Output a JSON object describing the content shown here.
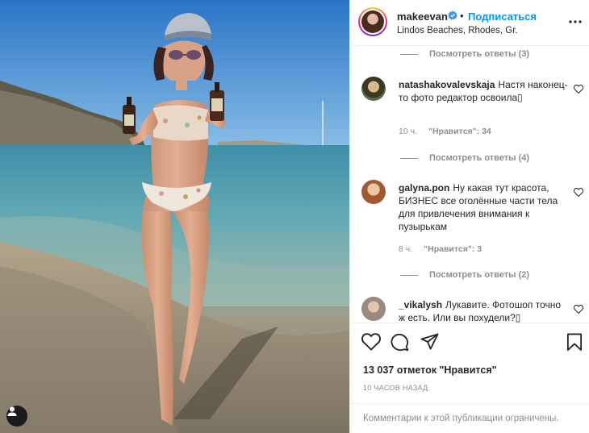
{
  "post": {
    "username": "makeevan",
    "follow_label": "Подписаться",
    "separator": "•",
    "location": "Lindos Beaches, Rhodes, Gr.",
    "likes_text": "13 037 отметок \"Нравится\"",
    "time_ago": "10 ЧАСОВ НАЗАД",
    "comments_restricted": "Комментарии к этой публикации ограничены."
  },
  "comments": {
    "replies": [
      {
        "label": "Посмотреть ответы (3)"
      },
      {
        "label": "Посмотреть ответы (4)"
      },
      {
        "label": "Посмотреть ответы (2)"
      }
    ],
    "items": [
      {
        "user": "natashakovalevskaja",
        "text": "Настя наконец-то фото редактор освоила▯",
        "time": "10 ч.",
        "likes": "\"Нравится\": 34"
      },
      {
        "user": "galyna.pon",
        "text": "Ну какая тут красота, БИЗНЕС все оголённые части тела для привлечения внимания к пузырькам",
        "time": "8 ч.",
        "likes": "\"Нравится\": 3"
      },
      {
        "user": "_vikalysh",
        "text": "Лукавите. Фотошоп точно ж есть. Или вы похудели?▯",
        "time": "",
        "likes": ""
      }
    ]
  },
  "icons": {
    "verified": "verified-badge-icon",
    "more": "more-options-icon",
    "like": "heart-icon",
    "comment": "comment-icon",
    "share": "paper-plane-icon",
    "save": "bookmark-icon",
    "user_tag": "user-tag-icon"
  },
  "colors": {
    "accent": "#0095f6",
    "text": "#262626",
    "muted": "#8e8e8e"
  }
}
